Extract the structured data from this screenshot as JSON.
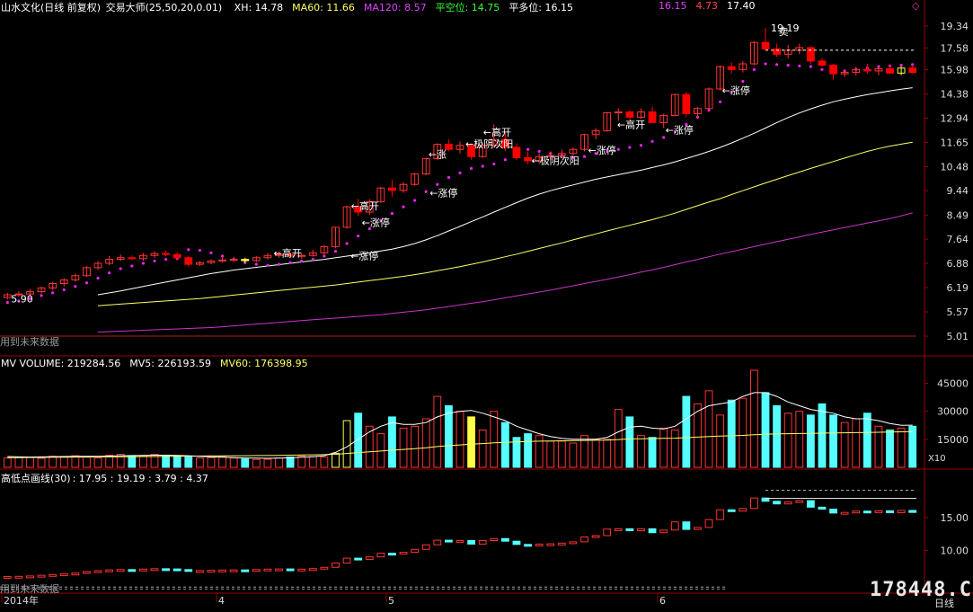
{
  "header": {
    "title": "山水文化(日线 前复权)",
    "indicator_name": "交易大师",
    "indicator_params": "(25,50,20,0.01)",
    "items": [
      {
        "label": "XH: 14.78",
        "color": "#ffffff"
      },
      {
        "label": "MA60: 11.66",
        "color": "#ffff66"
      },
      {
        "label": "MA120: 8.57",
        "color": "#e040ff"
      },
      {
        "label": "平空位: 14.75",
        "color": "#33ff33"
      },
      {
        "label": "平多位: 16.15",
        "color": "#ffffff"
      }
    ],
    "mid_values": [
      {
        "label": "16.15",
        "color": "#e040ff"
      },
      {
        "label": "4.73",
        "color": "#ff4444"
      },
      {
        "label": "17.40",
        "color": "#ffffff"
      }
    ],
    "corner_icon": "diamond-icon"
  },
  "volume_header": {
    "items": [
      {
        "label": "MV VOLUME: 219284.56",
        "color": "#ffffff"
      },
      {
        "label": "MV5: 226193.59",
        "color": "#ffffff"
      },
      {
        "label": "MV60: 176398.95",
        "color": "#ffff66"
      }
    ]
  },
  "indicator_header": {
    "name": "高低点画线(30)",
    "values": ": 17.95 : 19.19 : 3.79 : 4.37"
  },
  "future_label": "用到未来数据",
  "annotations": {
    "high": "19.19",
    "low": "5.90",
    "sell": "卖",
    "limit_up": "←涨停",
    "gap_up": "←高开",
    "extreme_yin": "←极阴次阳",
    "limit_up_partial": "←涨",
    "extreme_partial": "←极阴次阳"
  },
  "x_axis": {
    "labels": [
      "2014年",
      "4",
      "5",
      "6"
    ],
    "timeframe": "日线"
  },
  "watermark": "178448.COM",
  "multiplier_label": "X10",
  "colors": {
    "up": "#ff3333",
    "down": "#ff0000",
    "ma_white": "#ffffff",
    "ma60": "#ffff66",
    "ma120": "#cc33cc",
    "dots": "#ee22ee",
    "volume_up": "#ff3333",
    "volume_down": "#55ffff",
    "grid": "#990000"
  },
  "chart_data": [
    {
      "type": "candlestick",
      "title": "山水文化(日线 前复权)",
      "y_axis_ticks": [
        "19.34",
        "17.58",
        "15.98",
        "14.38",
        "12.94",
        "11.65",
        "10.48",
        "9.44",
        "8.49",
        "7.64",
        "6.88",
        "6.19",
        "5.57",
        "5.01"
      ],
      "y_scale": "log",
      "ylim": [
        4.8,
        20.5
      ],
      "candles": [
        [
          5.93,
          6.05,
          5.88,
          6.0
        ],
        [
          6.0,
          6.1,
          5.95,
          6.02
        ],
        [
          6.02,
          6.15,
          5.98,
          6.08
        ],
        [
          6.08,
          6.22,
          6.03,
          6.18
        ],
        [
          6.18,
          6.35,
          6.12,
          6.3
        ],
        [
          6.3,
          6.45,
          6.22,
          6.4
        ],
        [
          6.4,
          6.58,
          6.35,
          6.52
        ],
        [
          6.52,
          6.8,
          6.48,
          6.75
        ],
        [
          6.75,
          6.95,
          6.68,
          6.88
        ],
        [
          6.88,
          7.1,
          6.82,
          7.0
        ],
        [
          7.0,
          7.15,
          6.95,
          7.05
        ],
        [
          7.05,
          7.12,
          6.98,
          7.02
        ],
        [
          7.02,
          7.2,
          6.96,
          7.12
        ],
        [
          7.12,
          7.25,
          7.05,
          7.18
        ],
        [
          7.18,
          7.28,
          7.1,
          7.15
        ],
        [
          7.15,
          7.22,
          6.98,
          7.05
        ],
        [
          7.05,
          7.1,
          6.78,
          6.85
        ],
        [
          6.85,
          6.95,
          6.8,
          6.9
        ],
        [
          6.9,
          7.0,
          6.85,
          6.95
        ],
        [
          6.95,
          7.05,
          6.9,
          6.98
        ],
        [
          6.98,
          7.08,
          6.92,
          7.0
        ],
        [
          7.0,
          7.05,
          6.9,
          6.96
        ],
        [
          6.96,
          7.1,
          6.92,
          7.05
        ],
        [
          7.05,
          7.18,
          7.0,
          7.12
        ],
        [
          7.12,
          7.25,
          7.05,
          7.15
        ],
        [
          7.15,
          7.22,
          7.05,
          7.1
        ],
        [
          7.1,
          7.2,
          7.02,
          7.12
        ],
        [
          7.12,
          7.3,
          7.08,
          7.2
        ],
        [
          7.2,
          7.45,
          7.15,
          7.4
        ],
        [
          7.4,
          8.05,
          7.35,
          8.05
        ],
        [
          8.05,
          8.85,
          8.0,
          8.8
        ],
        [
          8.8,
          9.1,
          8.45,
          8.6
        ],
        [
          8.6,
          9.1,
          8.5,
          9.0
        ],
        [
          9.0,
          9.6,
          8.95,
          9.55
        ],
        [
          9.55,
          9.9,
          9.2,
          9.45
        ],
        [
          9.45,
          9.8,
          9.35,
          9.7
        ],
        [
          9.7,
          10.2,
          9.65,
          10.15
        ],
        [
          10.15,
          10.9,
          10.1,
          10.85
        ],
        [
          10.85,
          11.6,
          10.8,
          11.55
        ],
        [
          11.55,
          11.8,
          11.2,
          11.3
        ],
        [
          11.3,
          11.7,
          11.1,
          11.5
        ],
        [
          11.5,
          11.6,
          10.8,
          10.95
        ],
        [
          10.95,
          11.6,
          10.9,
          11.5
        ],
        [
          11.5,
          12.6,
          11.4,
          11.8
        ],
        [
          11.8,
          12.2,
          11.2,
          11.4
        ],
        [
          11.4,
          11.6,
          10.8,
          10.9
        ],
        [
          10.9,
          11.2,
          10.6,
          10.75
        ],
        [
          10.75,
          11.1,
          10.6,
          10.95
        ],
        [
          10.95,
          11.2,
          10.8,
          11.0
        ],
        [
          11.0,
          11.3,
          10.85,
          11.1
        ],
        [
          11.1,
          11.4,
          11.0,
          11.3
        ],
        [
          11.3,
          12.1,
          11.2,
          12.05
        ],
        [
          12.05,
          12.4,
          11.8,
          12.25
        ],
        [
          12.25,
          13.3,
          12.2,
          13.25
        ],
        [
          13.25,
          13.5,
          12.8,
          13.3
        ],
        [
          13.3,
          13.4,
          12.9,
          13.0
        ],
        [
          13.0,
          13.5,
          12.9,
          13.3
        ],
        [
          13.3,
          13.6,
          12.8,
          12.7
        ],
        [
          12.7,
          13.2,
          12.4,
          13.1
        ],
        [
          13.1,
          14.4,
          13.05,
          14.35
        ],
        [
          14.35,
          14.5,
          13.0,
          13.2
        ],
        [
          13.2,
          13.6,
          13.0,
          13.5
        ],
        [
          13.5,
          14.8,
          13.4,
          14.7
        ],
        [
          14.7,
          16.3,
          14.6,
          16.2
        ],
        [
          16.2,
          16.5,
          15.7,
          16.0
        ],
        [
          16.0,
          16.6,
          15.8,
          16.4
        ],
        [
          16.4,
          18.1,
          16.3,
          18.0
        ],
        [
          18.0,
          19.19,
          17.4,
          17.5
        ],
        [
          17.5,
          17.9,
          16.9,
          17.1
        ],
        [
          17.1,
          17.8,
          16.8,
          17.4
        ],
        [
          17.4,
          17.9,
          17.1,
          17.6
        ],
        [
          17.6,
          17.7,
          16.4,
          16.6
        ],
        [
          16.6,
          16.8,
          16.2,
          16.3
        ],
        [
          16.3,
          16.4,
          15.3,
          15.7
        ],
        [
          15.7,
          16.0,
          15.5,
          15.8
        ],
        [
          15.8,
          16.2,
          15.6,
          16.0
        ],
        [
          16.0,
          16.4,
          15.7,
          15.9
        ],
        [
          15.9,
          16.2,
          15.6,
          16.05
        ],
        [
          16.05,
          16.3,
          15.7,
          15.75
        ],
        [
          15.75,
          16.2,
          15.6,
          16.1
        ],
        [
          16.1,
          16.3,
          15.7,
          15.8
        ]
      ],
      "sar_dots": [
        5.8,
        5.84,
        5.9,
        5.98,
        6.05,
        6.13,
        6.22,
        6.32,
        6.45,
        6.6,
        6.72,
        6.8,
        6.88,
        6.95,
        7.0,
        7.02,
        7.3,
        7.28,
        7.2,
        7.1,
        7.0,
        6.9,
        6.85,
        6.82,
        6.85,
        6.9,
        6.95,
        7.0,
        7.1,
        7.25,
        7.5,
        7.75,
        8.0,
        8.3,
        8.55,
        8.8,
        9.05,
        9.4,
        9.7,
        10.0,
        10.2,
        10.4,
        10.5,
        10.6,
        10.8,
        11.2,
        11.3,
        11.2,
        11.1,
        11.0,
        10.9,
        10.95,
        11.1,
        11.2,
        11.3,
        11.4,
        11.5,
        11.7,
        11.9,
        12.2,
        12.6,
        13.0,
        13.4,
        13.9,
        14.5,
        15.2,
        16.0,
        16.4,
        16.35,
        16.3,
        16.25,
        16.2,
        16.0,
        15.8,
        15.9,
        16.0,
        16.1,
        16.2,
        16.25,
        16.3,
        16.35
      ],
      "ma_white": [
        6.0,
        6.05,
        6.1,
        6.16,
        6.22,
        6.28,
        6.34,
        6.4,
        6.46,
        6.52,
        6.58,
        6.63,
        6.68,
        6.72,
        6.76,
        6.8,
        6.84,
        6.88,
        6.92,
        6.96,
        7.0,
        7.05,
        7.1,
        7.15,
        7.2,
        7.26,
        7.32,
        7.4,
        7.5,
        7.62,
        7.76,
        7.92,
        8.08,
        8.25,
        8.42,
        8.6,
        8.78,
        8.96,
        9.14,
        9.3,
        9.44,
        9.56,
        9.68,
        9.8,
        9.92,
        10.02,
        10.12,
        10.22,
        10.32,
        10.44,
        10.56,
        10.7,
        10.86,
        11.02,
        11.2,
        11.4,
        11.62,
        11.86,
        12.12,
        12.4,
        12.7,
        12.98,
        13.24,
        13.48,
        13.7,
        13.9,
        14.06,
        14.2,
        14.34,
        14.46,
        14.58,
        14.68,
        14.78
      ],
      "ma60": [
        5.72,
        5.74,
        5.76,
        5.78,
        5.8,
        5.82,
        5.84,
        5.86,
        5.88,
        5.9,
        5.93,
        5.96,
        5.99,
        6.02,
        6.05,
        6.08,
        6.11,
        6.14,
        6.17,
        6.2,
        6.23,
        6.26,
        6.3,
        6.34,
        6.38,
        6.42,
        6.46,
        6.5,
        6.55,
        6.6,
        6.66,
        6.72,
        6.78,
        6.85,
        6.92,
        7.0,
        7.08,
        7.16,
        7.25,
        7.34,
        7.43,
        7.52,
        7.62,
        7.72,
        7.82,
        7.92,
        8.02,
        8.12,
        8.22,
        8.32,
        8.44,
        8.56,
        8.7,
        8.84,
        8.98,
        9.12,
        9.28,
        9.44,
        9.6,
        9.76,
        9.92,
        10.08,
        10.24,
        10.4,
        10.56,
        10.72,
        10.88,
        11.04,
        11.2,
        11.34,
        11.46,
        11.56,
        11.66
      ],
      "ma120": [
        5.1,
        5.11,
        5.12,
        5.13,
        5.14,
        5.15,
        5.16,
        5.17,
        5.18,
        5.19,
        5.2,
        5.22,
        5.24,
        5.26,
        5.28,
        5.3,
        5.32,
        5.34,
        5.36,
        5.38,
        5.4,
        5.42,
        5.44,
        5.46,
        5.48,
        5.5,
        5.53,
        5.56,
        5.59,
        5.62,
        5.66,
        5.7,
        5.74,
        5.78,
        5.82,
        5.87,
        5.92,
        5.97,
        6.02,
        6.07,
        6.12,
        6.18,
        6.24,
        6.3,
        6.36,
        6.42,
        6.48,
        6.55,
        6.62,
        6.69,
        6.76,
        6.84,
        6.92,
        7.0,
        7.08,
        7.16,
        7.24,
        7.32,
        7.4,
        7.48,
        7.56,
        7.64,
        7.72,
        7.8,
        7.88,
        7.96,
        8.04,
        8.12,
        8.2,
        8.28,
        8.36,
        8.46,
        8.57
      ],
      "dashed_resistance": 17.4
    },
    {
      "type": "bar",
      "title": "MV VOLUME",
      "y_axis_ticks": [
        "45000",
        "30000",
        "15000"
      ],
      "ylim": [
        0,
        52000
      ],
      "unit_multiplier": "X10",
      "volume": [
        5000,
        5500,
        5200,
        4800,
        6000,
        5800,
        6200,
        5500,
        5000,
        6500,
        7000,
        6000,
        6200,
        7000,
        6500,
        6000,
        5500,
        5000,
        5200,
        5800,
        5000,
        4500,
        4200,
        4300,
        5000,
        5500,
        6000,
        5800,
        5500,
        7500,
        25000,
        29000,
        22000,
        18000,
        27000,
        21000,
        22000,
        26000,
        38000,
        33000,
        30000,
        27000,
        20000,
        30000,
        24000,
        16000,
        18000,
        17000,
        14000,
        14000,
        13000,
        17000,
        15000,
        15000,
        31000,
        27000,
        17000,
        16000,
        21000,
        20000,
        38000,
        34000,
        41000,
        28000,
        36000,
        37000,
        52000,
        40000,
        33000,
        29000,
        30000,
        28000,
        34000,
        28000,
        24000,
        26000,
        29000,
        22000,
        20000,
        21000,
        22000
      ],
      "yellow_bars": [
        29,
        30,
        41
      ],
      "mv5": [
        5800,
        5600,
        5500,
        5600,
        5700,
        5800,
        5900,
        5900,
        5900,
        6000,
        6200,
        6300,
        6400,
        6500,
        6500,
        6400,
        6200,
        5900,
        5600,
        5400,
        5200,
        5000,
        4900,
        4800,
        4900,
        5100,
        5400,
        5700,
        6200,
        8000,
        11000,
        15000,
        19000,
        22000,
        24000,
        23000,
        23000,
        24000,
        27000,
        29000,
        30000,
        30500,
        29000,
        27000,
        25000,
        22000,
        20000,
        18000,
        16500,
        15500,
        15000,
        15000,
        15000,
        16000,
        19000,
        21500,
        22000,
        21000,
        20500,
        22000,
        26000,
        30000,
        33000,
        34000,
        35000,
        38000,
        40000,
        40000,
        38000,
        35000,
        33000,
        31000,
        30000,
        29000,
        27000,
        26000,
        26000,
        25000,
        23500,
        22500,
        22600
      ],
      "mv60": [
        5200,
        5200,
        5300,
        5300,
        5400,
        5400,
        5500,
        5500,
        5600,
        5600,
        5700,
        5700,
        5800,
        5800,
        5900,
        5900,
        6000,
        6000,
        6100,
        6100,
        6200,
        6200,
        6300,
        6300,
        6400,
        6500,
        6600,
        6700,
        6800,
        7000,
        7400,
        7900,
        8300,
        8700,
        9200,
        9600,
        10000,
        10500,
        11100,
        11600,
        12000,
        12400,
        12700,
        13100,
        13400,
        13600,
        13800,
        14000,
        14100,
        14200,
        14300,
        14400,
        14500,
        14600,
        14900,
        15200,
        15300,
        15400,
        15500,
        15600,
        15900,
        16200,
        16500,
        16700,
        16900,
        17100,
        17500,
        17700,
        17900,
        18000,
        18100,
        18200,
        18300,
        18400,
        18500,
        18600,
        18700,
        18800,
        18900,
        19000,
        19100
      ]
    },
    {
      "type": "candlestick",
      "title": "高低点画线(30)",
      "y_axis_ticks": [
        "15.00",
        "10.00"
      ],
      "ylim": [
        4.0,
        20.5
      ],
      "dashed_levels": [
        19.19,
        17.95,
        4.37,
        3.79
      ]
    }
  ]
}
